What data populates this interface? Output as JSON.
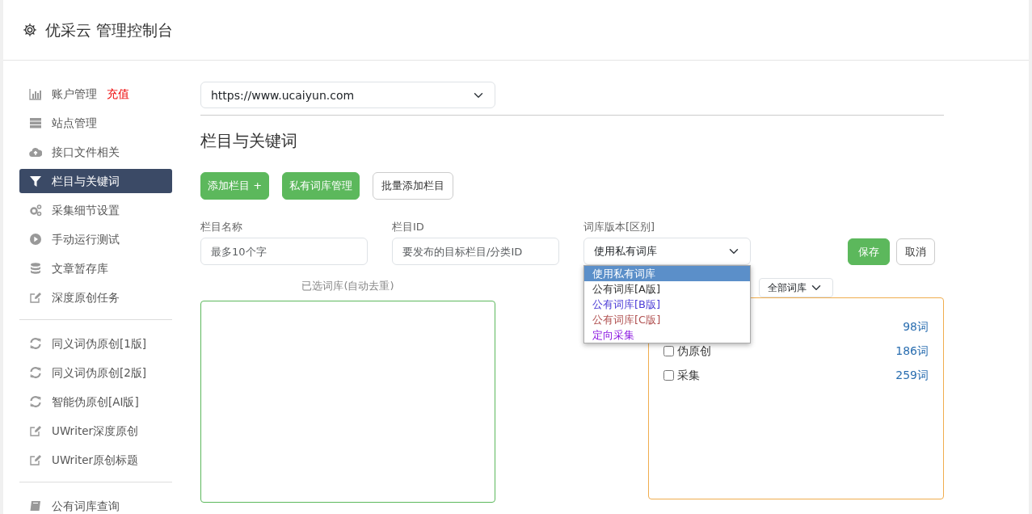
{
  "header": {
    "title": "优采云 管理控制台"
  },
  "sidebar": {
    "groups": [
      {
        "items": [
          {
            "label": "账户管理",
            "extra": "充值",
            "selected": false
          },
          {
            "label": "站点管理",
            "selected": false
          },
          {
            "label": "接口文件相关",
            "selected": false
          },
          {
            "label": "栏目与关键词",
            "selected": true
          },
          {
            "label": "采集细节设置",
            "selected": false
          },
          {
            "label": "手动运行测试",
            "selected": false
          },
          {
            "label": "文章暂存库",
            "selected": false
          },
          {
            "label": "深度原创任务",
            "selected": false
          }
        ]
      },
      {
        "items": [
          {
            "label": "同义词伪原创[1版]",
            "selected": false
          },
          {
            "label": "同义词伪原创[2版]",
            "selected": false
          },
          {
            "label": "智能伪原创[AI版]",
            "selected": false
          },
          {
            "label": "UWriter深度原创",
            "selected": false
          },
          {
            "label": "UWriter原创标题",
            "selected": false
          }
        ]
      },
      {
        "items": [
          {
            "label": "公有词库查询",
            "selected": false
          }
        ]
      }
    ]
  },
  "site_select": {
    "value": "https://www.ucaiyun.com"
  },
  "section_title": "栏目与关键词",
  "buttons": [
    {
      "label": "添加栏目 +",
      "kind": "success"
    },
    {
      "label": "私有词库管理",
      "kind": "success"
    },
    {
      "label": "批量添加栏目",
      "kind": "outline"
    }
  ],
  "form": {
    "fields": [
      {
        "label": "栏目名称",
        "placeholder": "最多10个字",
        "kind": "input"
      },
      {
        "label": "栏目ID",
        "placeholder": "要发布的目标栏目/分类ID",
        "kind": "input"
      },
      {
        "label": "词库版本[区别]",
        "value": "使用私有词库",
        "kind": "select",
        "expanded": true,
        "options": [
          {
            "label": "使用私有词库",
            "selected": true
          },
          {
            "label": "公有词库[A版]",
            "selected": false,
            "color": "#333333"
          },
          {
            "label": "公有词库[B版]",
            "selected": false,
            "color": "#4b3bd6"
          },
          {
            "label": "公有词库[C版]",
            "selected": false,
            "color": "#b05050"
          },
          {
            "label": "定向采集",
            "selected": false,
            "color": "#8a17e0"
          }
        ]
      }
    ],
    "save": "保存",
    "cancel": "取消"
  },
  "selected_box": {
    "title": "已选词库(自动去重)"
  },
  "library_box": {
    "filter": "全部词库",
    "rows": [
      {
        "count": "98词"
      },
      {
        "label": "伪原创",
        "count": "186词",
        "checked": false
      },
      {
        "label": "采集",
        "count": "259词",
        "checked": false
      }
    ]
  }
}
